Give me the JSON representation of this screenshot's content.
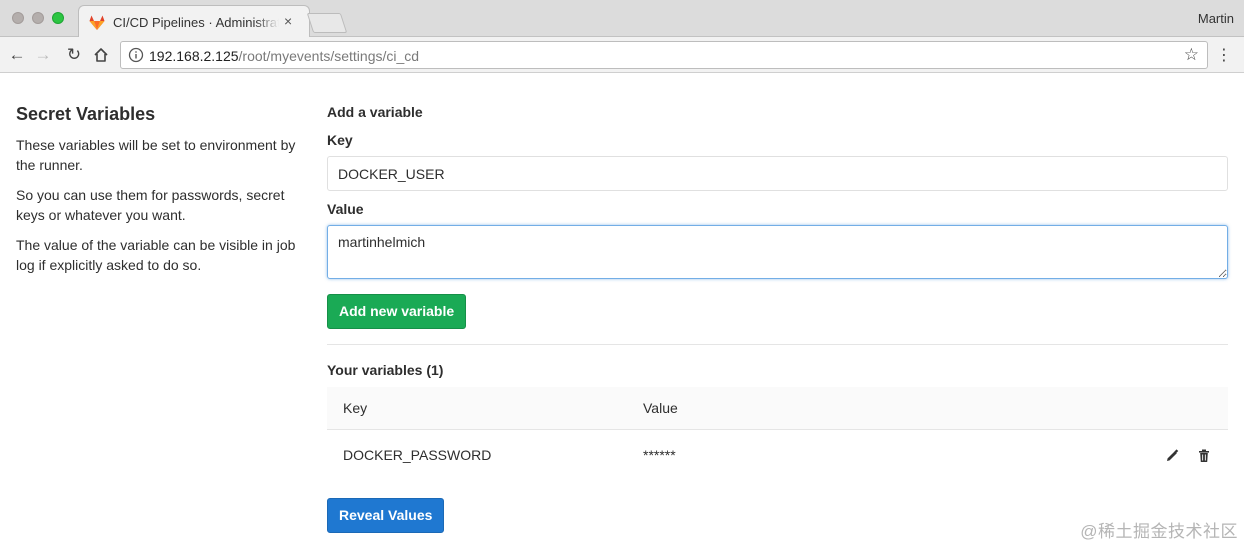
{
  "browser": {
    "tab_title": "CI/CD Pipelines · Administrator",
    "tab_close": "×",
    "profile_name": "Martin",
    "url_host": "192.168.2.125",
    "url_path": "/root/myevents/settings/ci_cd",
    "icons": {
      "back": "←",
      "forward": "→",
      "reload": "↻",
      "star": "☆",
      "menu": "⋮"
    }
  },
  "sidebar": {
    "title": "Secret Variables",
    "paragraphs": [
      "These variables will be set to environment by the runner.",
      "So you can use them for passwords, secret keys or whatever you want.",
      "The value of the variable can be visible in job log if explicitly asked to do so."
    ]
  },
  "form": {
    "section_title": "Add a variable",
    "key_label": "Key",
    "key_value": "DOCKER_USER",
    "value_label": "Value",
    "value_value": "martinhelmich",
    "add_button": "Add new variable"
  },
  "variables": {
    "title": "Your variables (1)",
    "columns": [
      "Key",
      "Value"
    ],
    "rows": [
      {
        "key": "DOCKER_PASSWORD",
        "value": "******"
      }
    ],
    "reveal_button": "Reveal Values"
  },
  "watermark": "@稀土掘金技术社区",
  "colors": {
    "green_button": "#1aaa55",
    "blue_button": "#1f78d1",
    "focus_border": "#73aee6"
  }
}
